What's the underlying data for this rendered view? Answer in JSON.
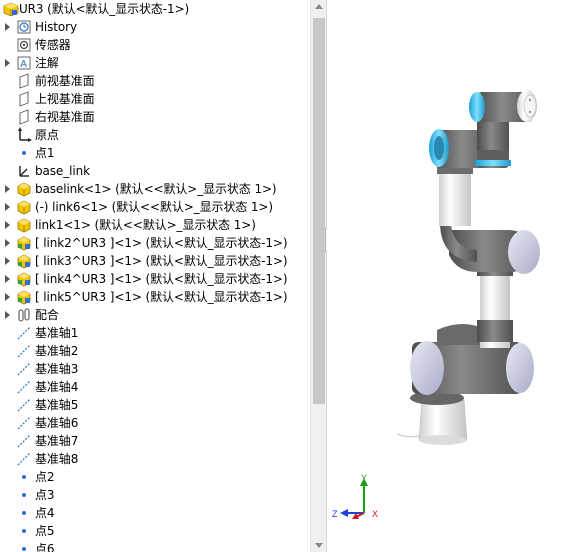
{
  "tree": {
    "root": "UR3  (默认<默认_显示状态-1>)",
    "items": [
      {
        "label": "History",
        "icon": "history-icon",
        "expand": true
      },
      {
        "label": "传感器",
        "icon": "sensor-icon",
        "expand": false
      },
      {
        "label": "注解",
        "icon": "annotation-icon",
        "expand": true
      },
      {
        "label": "前视基准面",
        "icon": "plane-icon",
        "expand": false
      },
      {
        "label": "上视基准面",
        "icon": "plane-icon",
        "expand": false
      },
      {
        "label": "右视基准面",
        "icon": "plane-icon",
        "expand": false
      },
      {
        "label": "原点",
        "icon": "origin-icon",
        "expand": false
      },
      {
        "label": "点1",
        "icon": "point-icon",
        "expand": false
      },
      {
        "label": "base_link",
        "icon": "coordinate-system-icon",
        "expand": false
      },
      {
        "label": "baselink<1> (默认<<默认>_显示状态 1>)",
        "icon": "part-icon",
        "expand": true
      },
      {
        "label": "(-) link6<1> (默认<<默认>_显示状态 1>)",
        "icon": "part-icon",
        "expand": true
      },
      {
        "label": "link1<1> (默认<<默认>_显示状态 1>)",
        "icon": "part-icon",
        "expand": true
      },
      {
        "label": "[ link2^UR3 ]<1> (默认<默认_显示状态-1>)",
        "icon": "subassembly-icon",
        "expand": true
      },
      {
        "label": "[ link3^UR3 ]<1> (默认<默认_显示状态-1>)",
        "icon": "subassembly-icon",
        "expand": true
      },
      {
        "label": "[ link4^UR3 ]<1> (默认<默认_显示状态-1>)",
        "icon": "subassembly-icon",
        "expand": true
      },
      {
        "label": "[ link5^UR3 ]<1> (默认<默认_显示状态-1>)",
        "icon": "subassembly-icon",
        "expand": true
      },
      {
        "label": "配合",
        "icon": "mates-icon",
        "expand": true
      },
      {
        "label": "基准轴1",
        "icon": "axis-icon",
        "expand": false
      },
      {
        "label": "基准轴2",
        "icon": "axis-icon",
        "expand": false
      },
      {
        "label": "基准轴3",
        "icon": "axis-icon",
        "expand": false
      },
      {
        "label": "基准轴4",
        "icon": "axis-icon",
        "expand": false
      },
      {
        "label": "基准轴5",
        "icon": "axis-icon",
        "expand": false
      },
      {
        "label": "基准轴6",
        "icon": "axis-icon",
        "expand": false
      },
      {
        "label": "基准轴7",
        "icon": "axis-icon",
        "expand": false
      },
      {
        "label": "基准轴8",
        "icon": "axis-icon",
        "expand": false
      },
      {
        "label": "点2",
        "icon": "point-icon",
        "expand": false
      },
      {
        "label": "点3",
        "icon": "point-icon",
        "expand": false
      },
      {
        "label": "点4",
        "icon": "point-icon",
        "expand": false
      },
      {
        "label": "点5",
        "icon": "point-icon",
        "expand": false
      },
      {
        "label": "点6",
        "icon": "point-icon",
        "expand": false
      }
    ]
  },
  "triad": {
    "x": "X",
    "y": "Y",
    "z": "Z"
  },
  "colors": {
    "arm_gray": "#707070",
    "joint_cap": "#c9cbe0",
    "accent_cyan": "#39b7e3",
    "body_white": "#f0f0f0"
  }
}
